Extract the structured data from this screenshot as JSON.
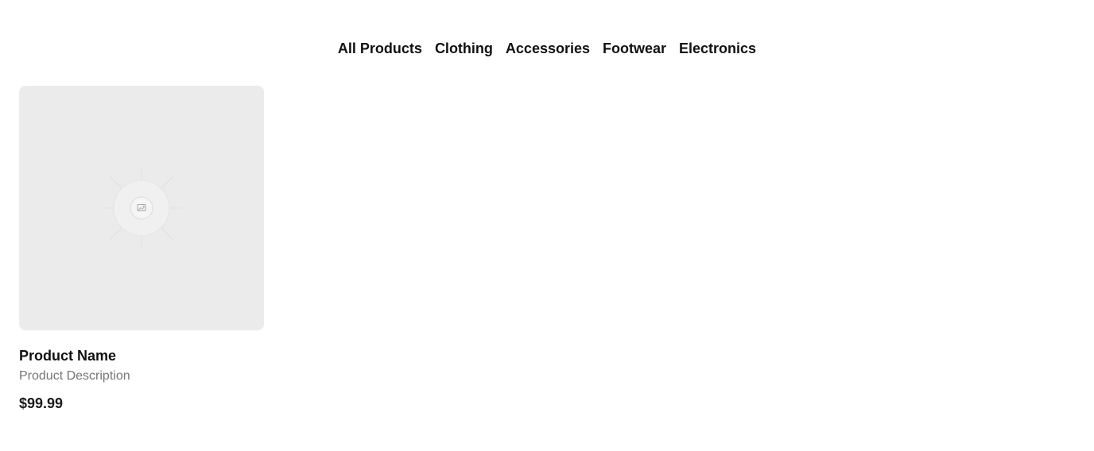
{
  "nav": {
    "categories": [
      {
        "label": "All Products"
      },
      {
        "label": "Clothing"
      },
      {
        "label": "Accessories"
      },
      {
        "label": "Footwear"
      },
      {
        "label": "Electronics"
      }
    ]
  },
  "products": [
    {
      "name": "Product Name",
      "description": "Product Description",
      "price": "$99.99",
      "image_icon": "image-placeholder-icon"
    }
  ],
  "colors": {
    "image_background": "#ebebeb",
    "description_text": "#757575",
    "primary_text": "#111111"
  }
}
